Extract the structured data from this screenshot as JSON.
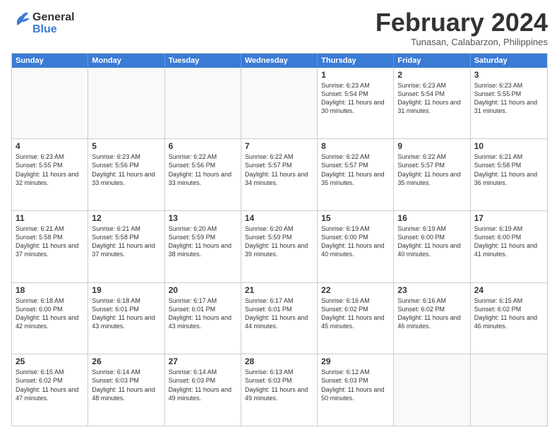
{
  "header": {
    "logo_general": "General",
    "logo_blue": "Blue",
    "month_title": "February 2024",
    "location": "Tunasan, Calabarzon, Philippines"
  },
  "days_of_week": [
    "Sunday",
    "Monday",
    "Tuesday",
    "Wednesday",
    "Thursday",
    "Friday",
    "Saturday"
  ],
  "weeks": [
    [
      {
        "day": "",
        "info": ""
      },
      {
        "day": "",
        "info": ""
      },
      {
        "day": "",
        "info": ""
      },
      {
        "day": "",
        "info": ""
      },
      {
        "day": "1",
        "info": "Sunrise: 6:23 AM\nSunset: 5:54 PM\nDaylight: 11 hours and 30 minutes."
      },
      {
        "day": "2",
        "info": "Sunrise: 6:23 AM\nSunset: 5:54 PM\nDaylight: 11 hours and 31 minutes."
      },
      {
        "day": "3",
        "info": "Sunrise: 6:23 AM\nSunset: 5:55 PM\nDaylight: 11 hours and 31 minutes."
      }
    ],
    [
      {
        "day": "4",
        "info": "Sunrise: 6:23 AM\nSunset: 5:55 PM\nDaylight: 11 hours and 32 minutes."
      },
      {
        "day": "5",
        "info": "Sunrise: 6:23 AM\nSunset: 5:56 PM\nDaylight: 11 hours and 33 minutes."
      },
      {
        "day": "6",
        "info": "Sunrise: 6:22 AM\nSunset: 5:56 PM\nDaylight: 11 hours and 33 minutes."
      },
      {
        "day": "7",
        "info": "Sunrise: 6:22 AM\nSunset: 5:57 PM\nDaylight: 11 hours and 34 minutes."
      },
      {
        "day": "8",
        "info": "Sunrise: 6:22 AM\nSunset: 5:57 PM\nDaylight: 11 hours and 35 minutes."
      },
      {
        "day": "9",
        "info": "Sunrise: 6:22 AM\nSunset: 5:57 PM\nDaylight: 11 hours and 35 minutes."
      },
      {
        "day": "10",
        "info": "Sunrise: 6:21 AM\nSunset: 5:58 PM\nDaylight: 11 hours and 36 minutes."
      }
    ],
    [
      {
        "day": "11",
        "info": "Sunrise: 6:21 AM\nSunset: 5:58 PM\nDaylight: 11 hours and 37 minutes."
      },
      {
        "day": "12",
        "info": "Sunrise: 6:21 AM\nSunset: 5:58 PM\nDaylight: 11 hours and 37 minutes."
      },
      {
        "day": "13",
        "info": "Sunrise: 6:20 AM\nSunset: 5:59 PM\nDaylight: 11 hours and 38 minutes."
      },
      {
        "day": "14",
        "info": "Sunrise: 6:20 AM\nSunset: 5:59 PM\nDaylight: 11 hours and 39 minutes."
      },
      {
        "day": "15",
        "info": "Sunrise: 6:19 AM\nSunset: 6:00 PM\nDaylight: 11 hours and 40 minutes."
      },
      {
        "day": "16",
        "info": "Sunrise: 6:19 AM\nSunset: 6:00 PM\nDaylight: 11 hours and 40 minutes."
      },
      {
        "day": "17",
        "info": "Sunrise: 6:19 AM\nSunset: 6:00 PM\nDaylight: 11 hours and 41 minutes."
      }
    ],
    [
      {
        "day": "18",
        "info": "Sunrise: 6:18 AM\nSunset: 6:00 PM\nDaylight: 11 hours and 42 minutes."
      },
      {
        "day": "19",
        "info": "Sunrise: 6:18 AM\nSunset: 6:01 PM\nDaylight: 11 hours and 43 minutes."
      },
      {
        "day": "20",
        "info": "Sunrise: 6:17 AM\nSunset: 6:01 PM\nDaylight: 11 hours and 43 minutes."
      },
      {
        "day": "21",
        "info": "Sunrise: 6:17 AM\nSunset: 6:01 PM\nDaylight: 11 hours and 44 minutes."
      },
      {
        "day": "22",
        "info": "Sunrise: 6:16 AM\nSunset: 6:02 PM\nDaylight: 11 hours and 45 minutes."
      },
      {
        "day": "23",
        "info": "Sunrise: 6:16 AM\nSunset: 6:02 PM\nDaylight: 11 hours and 46 minutes."
      },
      {
        "day": "24",
        "info": "Sunrise: 6:15 AM\nSunset: 6:02 PM\nDaylight: 11 hours and 46 minutes."
      }
    ],
    [
      {
        "day": "25",
        "info": "Sunrise: 6:15 AM\nSunset: 6:02 PM\nDaylight: 11 hours and 47 minutes."
      },
      {
        "day": "26",
        "info": "Sunrise: 6:14 AM\nSunset: 6:03 PM\nDaylight: 11 hours and 48 minutes."
      },
      {
        "day": "27",
        "info": "Sunrise: 6:14 AM\nSunset: 6:03 PM\nDaylight: 11 hours and 49 minutes."
      },
      {
        "day": "28",
        "info": "Sunrise: 6:13 AM\nSunset: 6:03 PM\nDaylight: 11 hours and 49 minutes."
      },
      {
        "day": "29",
        "info": "Sunrise: 6:12 AM\nSunset: 6:03 PM\nDaylight: 11 hours and 50 minutes."
      },
      {
        "day": "",
        "info": ""
      },
      {
        "day": "",
        "info": ""
      }
    ]
  ]
}
